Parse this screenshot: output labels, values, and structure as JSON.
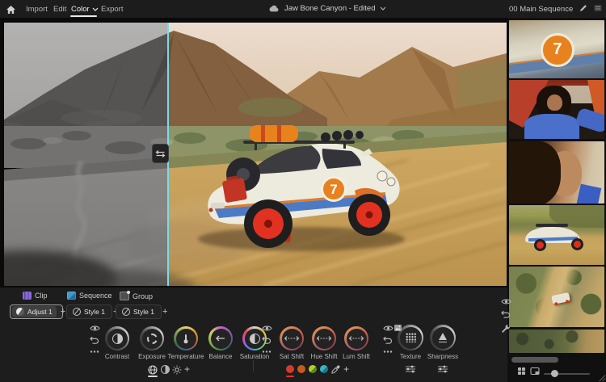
{
  "topbar": {
    "tabs": [
      {
        "label": "Import"
      },
      {
        "label": "Edit"
      },
      {
        "label": "Color"
      },
      {
        "label": "Export"
      }
    ],
    "active_tab": "Color",
    "project_name": "Jaw Bone Canyon - Edited",
    "sequence_name": "00 Main Sequence"
  },
  "preview": {
    "car_number": "7",
    "split_accent_color": "#7adbe8"
  },
  "filmstrip": {
    "thumbnails": [
      {
        "name": "car-door-number-7"
      },
      {
        "name": "driver-in-blue-shirt"
      },
      {
        "name": "driver-closeup"
      },
      {
        "name": "car-on-dirt-road"
      },
      {
        "name": "aerial-car-on-trail"
      },
      {
        "name": "aerial-terrain"
      }
    ]
  },
  "panel": {
    "tabs": [
      {
        "label": "Clip"
      },
      {
        "label": "Sequence"
      },
      {
        "label": "Group"
      }
    ],
    "presets": [
      {
        "label": "Adjust 1",
        "selected": true
      },
      {
        "label": "Style 1",
        "selected": false
      },
      {
        "label": "Style 1",
        "selected": false
      }
    ],
    "add_label": "+",
    "dial_groups": [
      {
        "dials": [
          {
            "label": "Contrast"
          },
          {
            "label": "Exposure"
          },
          {
            "label": "Temperature"
          },
          {
            "label": "Balance"
          },
          {
            "label": "Saturation"
          }
        ]
      },
      {
        "dials": [
          {
            "label": "Sat Shift"
          },
          {
            "label": "Hue Shift"
          },
          {
            "label": "Lum Shift"
          }
        ]
      },
      {
        "dials": [
          {
            "label": "Texture"
          },
          {
            "label": "Sharpness"
          }
        ]
      }
    ],
    "swatches": {
      "red": "#d5392c",
      "orange": "#c85a1f",
      "green": "#a0bc27",
      "teal": "#2fa0b0"
    }
  }
}
